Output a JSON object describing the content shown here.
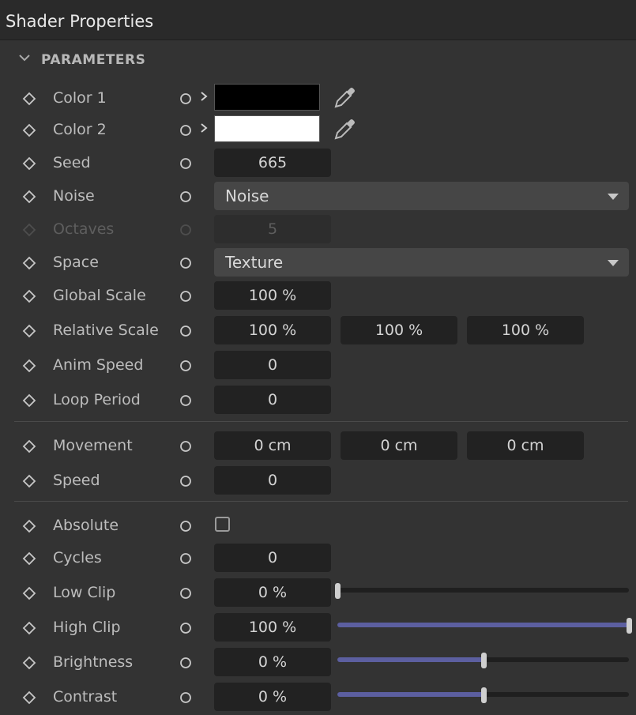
{
  "panel": {
    "title": "Shader Properties",
    "section": "PARAMETERS"
  },
  "colors": {
    "accent": "#5c5fa0",
    "color1": "#000000",
    "color2": "#ffffff"
  },
  "rows": {
    "color1": {
      "label": "Color 1",
      "swatch": "#000000"
    },
    "color2": {
      "label": "Color 2",
      "swatch": "#ffffff"
    },
    "seed": {
      "label": "Seed",
      "value": "665"
    },
    "noise": {
      "label": "Noise",
      "selected": "Noise"
    },
    "octaves": {
      "label": "Octaves",
      "value": "5"
    },
    "space": {
      "label": "Space",
      "selected": "Texture"
    },
    "global_scale": {
      "label": "Global Scale",
      "value": "100 %"
    },
    "relative_scale": {
      "label": "Relative Scale",
      "values": [
        "100 %",
        "100 %",
        "100 %"
      ]
    },
    "anim_speed": {
      "label": "Anim Speed",
      "value": "0"
    },
    "loop_period": {
      "label": "Loop Period",
      "value": "0"
    },
    "movement": {
      "label": "Movement",
      "values": [
        "0 cm",
        "0 cm",
        "0 cm"
      ]
    },
    "speed": {
      "label": "Speed",
      "value": "0"
    },
    "absolute": {
      "label": "Absolute",
      "checked": false
    },
    "cycles": {
      "label": "Cycles",
      "value": "0"
    },
    "low_clip": {
      "label": "Low Clip",
      "value": "0 %",
      "slider_fraction": 0.0
    },
    "high_clip": {
      "label": "High Clip",
      "value": "100 %",
      "slider_fraction": 1.0
    },
    "brightness": {
      "label": "Brightness",
      "value": "0 %",
      "slider_fraction": 0.5
    },
    "contrast": {
      "label": "Contrast",
      "value": "0 %",
      "slider_fraction": 0.5
    }
  },
  "icons": {
    "keyframe": "diamond-icon",
    "animate": "circle-icon",
    "expand": "chevron-right-icon",
    "picker": "eyedropper-icon",
    "collapse": "chevron-down-icon",
    "dropdown": "triangle-down-icon"
  }
}
